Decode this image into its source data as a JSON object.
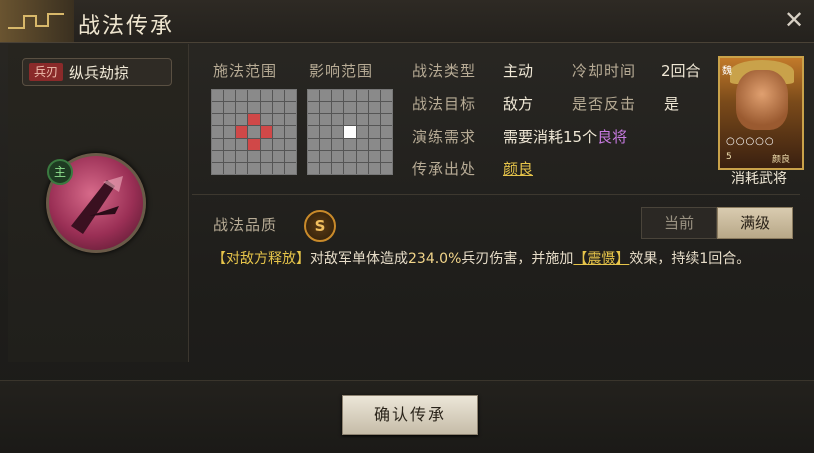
{
  "window": {
    "title": "战法传承"
  },
  "skill": {
    "tag": "兵刃",
    "name": "纵兵劫掠",
    "badge": "主"
  },
  "ranges": {
    "cast_label": "施法范围",
    "effect_label": "影响范围"
  },
  "info": {
    "type_label": "战法类型",
    "type_value": "主动",
    "cooldown_label": "冷却时间",
    "cooldown_value": "2回合",
    "target_label": "战法目标",
    "target_value": "敌方",
    "counter_label": "是否反击",
    "counter_value": "是",
    "req_label": "演练需求",
    "req_value_prefix": "需要消耗15个",
    "req_value_link": "良将",
    "source_label": "传承出处",
    "source_value": "颜良"
  },
  "general": {
    "side": "魏",
    "stars": "○○○○○",
    "cost_label": "5",
    "name_small": "颜良",
    "consume_label": "消耗武将"
  },
  "quality": {
    "label": "战法品质",
    "grade": "S"
  },
  "toggle": {
    "current": "当前",
    "max": "满级"
  },
  "description": {
    "tag1": "【对敌方释放】",
    "text1": "对敌军单体造成",
    "pct": "234.0%",
    "text2": "兵刃伤害，并施加",
    "tag2": "【震慑】",
    "text3": "效果，持续1回合。"
  },
  "buttons": {
    "confirm": "确认传承"
  },
  "colors": {
    "accent_gold": "#e6c44a",
    "purple": "#c77ae0",
    "tag_red": "#8a2a2a"
  }
}
